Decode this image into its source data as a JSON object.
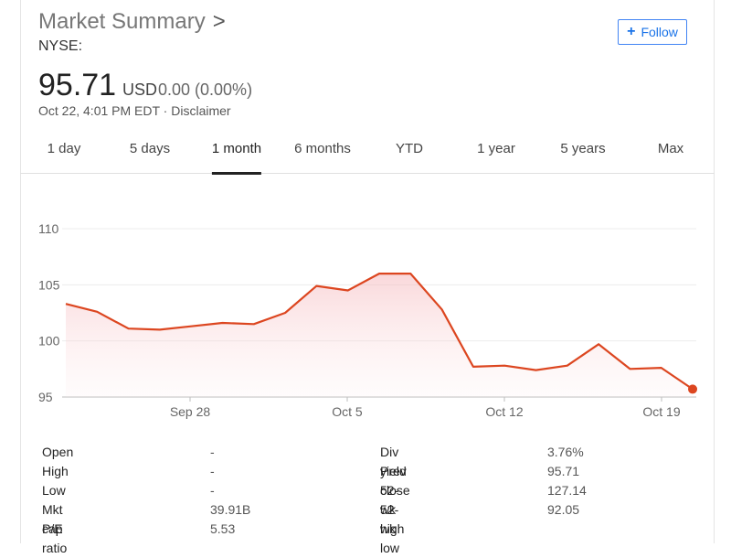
{
  "header": {
    "title": "Market Summary",
    "title_chevron": ">",
    "exchange": "NYSE:",
    "follow_label": "Follow"
  },
  "quote": {
    "price": "95.71",
    "currency": "USD",
    "change": "0.00 (0.00%)",
    "timestamp": "Oct 22, 4:01 PM EDT · Disclaimer"
  },
  "tabs": [
    "1 day",
    "5 days",
    "1 month",
    "6 months",
    "YTD",
    "1 year",
    "5 years",
    "Max"
  ],
  "active_tab": "1 month",
  "colors": {
    "line": "#dc4620",
    "accent": "#1a73e8"
  },
  "chart_data": {
    "type": "area",
    "y_ticks": [
      "110",
      "105",
      "100",
      "95"
    ],
    "x_tick_labels": [
      "Sep 28",
      "Oct 5",
      "Oct 12",
      "Oct 19"
    ],
    "ylim": [
      95,
      110
    ],
    "grid": true,
    "series": [
      {
        "values": [
          103.3,
          102.6,
          101.1,
          101.0,
          101.3,
          101.6,
          101.5,
          102.5,
          104.9,
          104.5,
          106.0,
          106.0,
          102.8,
          97.7,
          97.8,
          97.4,
          97.8,
          99.7,
          97.5,
          97.6,
          95.7
        ]
      }
    ]
  },
  "stats": {
    "left": [
      {
        "label": "Open",
        "value": "-"
      },
      {
        "label": "High",
        "value": "-"
      },
      {
        "label": "Low",
        "value": "-"
      },
      {
        "label": "Mkt cap",
        "value": "39.91B"
      },
      {
        "label": "P/E ratio",
        "value": "5.53"
      }
    ],
    "right": [
      {
        "label": "Div yield",
        "value": "3.76%"
      },
      {
        "label": "Prev close",
        "value": "95.71"
      },
      {
        "label": "52-wk high",
        "value": "127.14"
      },
      {
        "label": "52-wk low",
        "value": "92.05"
      }
    ]
  }
}
